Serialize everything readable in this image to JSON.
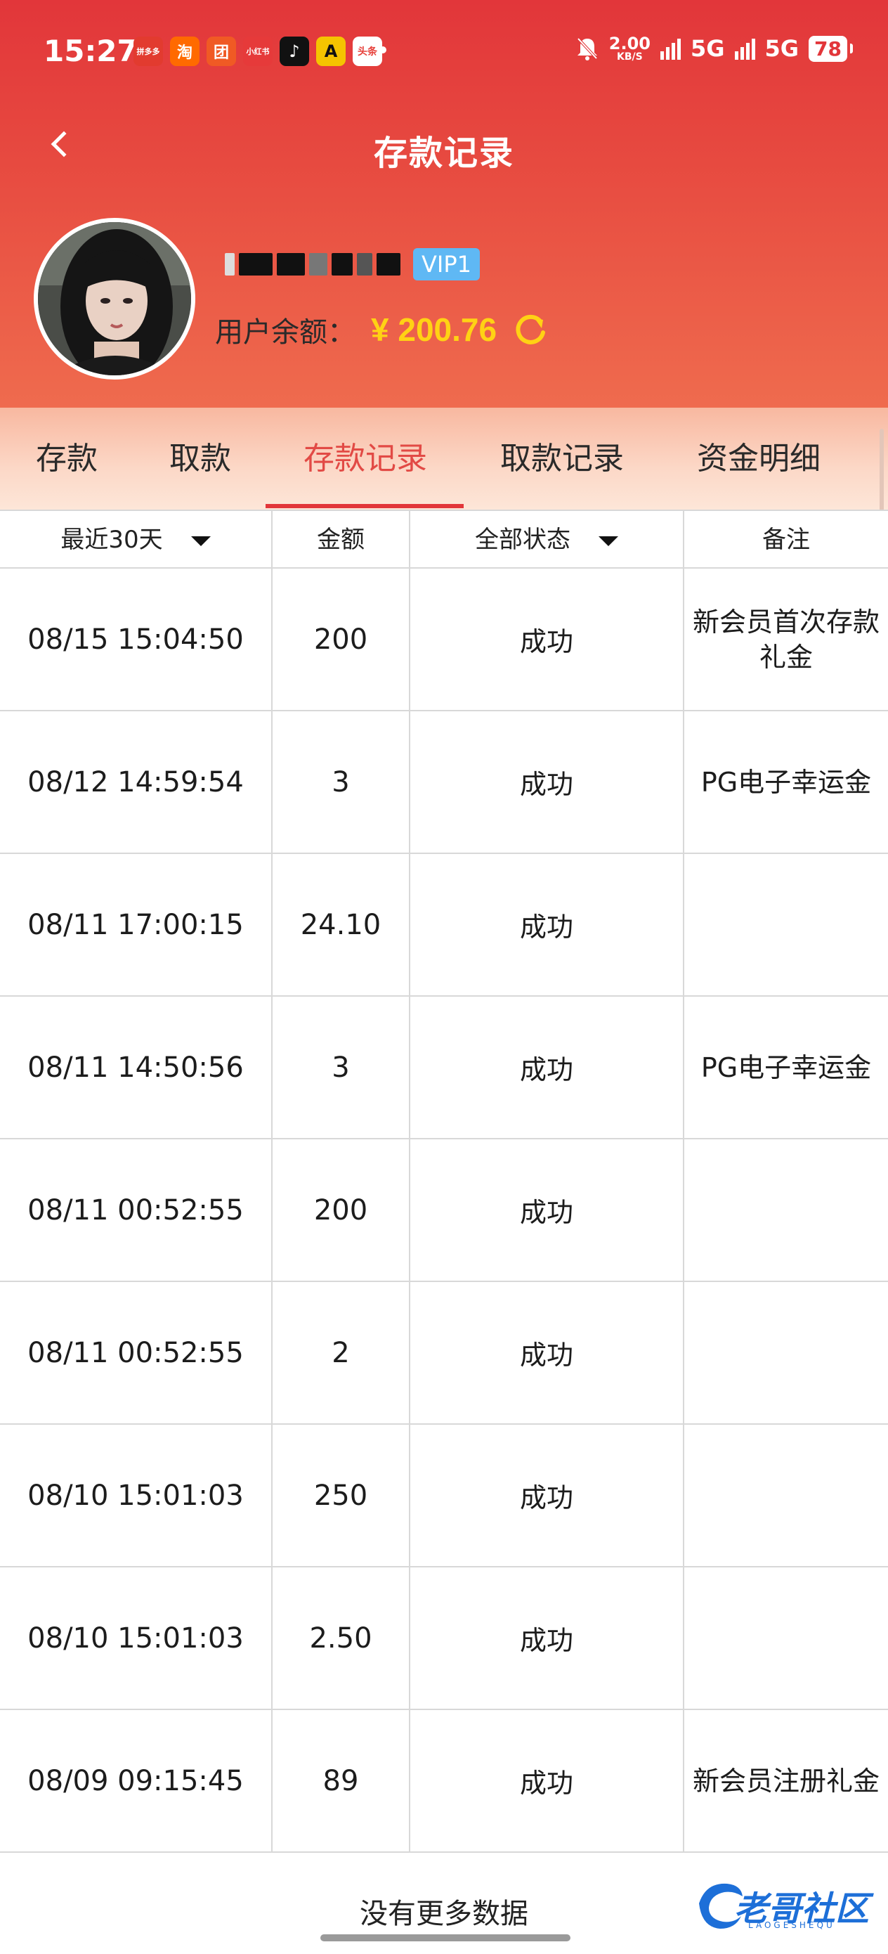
{
  "status_bar": {
    "time": "15:27",
    "apps": [
      {
        "icon": "app-pinduoduo-icon",
        "label": "拼多多",
        "color": "#e23b2f"
      },
      {
        "icon": "app-taobao-icon",
        "label": "淘",
        "color": "#ff6a00"
      },
      {
        "icon": "app-meituan-icon",
        "label": "团",
        "color": "#f05a24"
      },
      {
        "icon": "app-xiaohongshu-icon",
        "label": "小红书",
        "color": "#e63a3a"
      },
      {
        "icon": "app-tiktok-icon",
        "label": "♪",
        "color": "#111111"
      },
      {
        "icon": "app-a-icon",
        "label": "A",
        "color": "#f5c400"
      },
      {
        "icon": "app-toutiao-icon",
        "label": "头条",
        "color": "#e7403a"
      }
    ],
    "net_speed_value": "2.00",
    "net_speed_unit": "KB/S",
    "network_1": "5G",
    "network_2": "5G",
    "battery": "78"
  },
  "nav": {
    "title": "存款记录"
  },
  "profile": {
    "vip": "VIP1",
    "balance_label": "用户余额：",
    "balance_value": "¥ 200.76"
  },
  "tabs": [
    {
      "label": "存款",
      "active": false
    },
    {
      "label": "取款",
      "active": false
    },
    {
      "label": "存款记录",
      "active": true
    },
    {
      "label": "取款记录",
      "active": false
    },
    {
      "label": "资金明细",
      "active": false
    }
  ],
  "table": {
    "headers": {
      "period": "最近30天",
      "amount": "金额",
      "status": "全部状态",
      "note": "备注"
    },
    "rows": [
      {
        "time": "08/15 15:04:50",
        "amount": "200",
        "status": "成功",
        "note": "新会员首次存款礼金"
      },
      {
        "time": "08/12 14:59:54",
        "amount": "3",
        "status": "成功",
        "note": "PG电子幸运金"
      },
      {
        "time": "08/11 17:00:15",
        "amount": "24.10",
        "status": "成功",
        "note": ""
      },
      {
        "time": "08/11 14:50:56",
        "amount": "3",
        "status": "成功",
        "note": "PG电子幸运金"
      },
      {
        "time": "08/11 00:52:55",
        "amount": "200",
        "status": "成功",
        "note": ""
      },
      {
        "time": "08/11 00:52:55",
        "amount": "2",
        "status": "成功",
        "note": ""
      },
      {
        "time": "08/10 15:01:03",
        "amount": "250",
        "status": "成功",
        "note": ""
      },
      {
        "time": "08/10 15:01:03",
        "amount": "2.50",
        "status": "成功",
        "note": ""
      },
      {
        "time": "08/09 09:15:45",
        "amount": "89",
        "status": "成功",
        "note": "新会员注册礼金"
      }
    ]
  },
  "footer": {
    "no_more": "没有更多数据"
  },
  "watermark": {
    "text": "老哥社区",
    "sub": "LAOGESHEQU"
  },
  "colors": {
    "header_red": "#e2363a",
    "accent_tab": "#e24a45",
    "balance_yellow": "#ffd214",
    "vip_blue": "#5fb8f4"
  }
}
